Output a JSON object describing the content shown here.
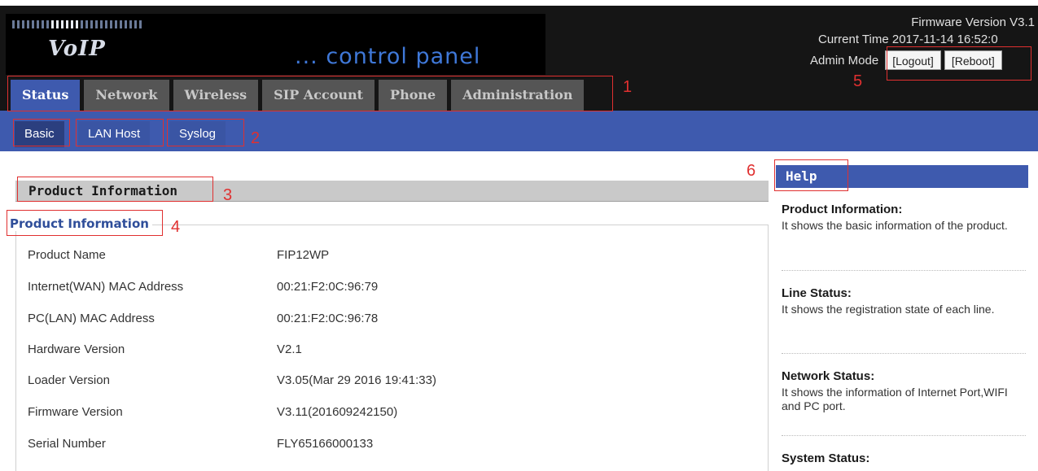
{
  "header": {
    "logo": "VoIP",
    "subtitle": "... control panel",
    "firmware_line": "Firmware Version V3.1",
    "time_line": "Current Time 2017-11-14 16:52:0",
    "admin_mode": "Admin Mode",
    "logout": "[Logout]",
    "reboot": "[Reboot]"
  },
  "tabs": [
    {
      "label": "Status"
    },
    {
      "label": "Network"
    },
    {
      "label": "Wireless"
    },
    {
      "label": "SIP Account"
    },
    {
      "label": "Phone"
    },
    {
      "label": "Administration"
    }
  ],
  "subtabs": [
    {
      "label": "Basic"
    },
    {
      "label": "LAN Host"
    },
    {
      "label": "Syslog"
    }
  ],
  "annotations": [
    "1",
    "2",
    "3",
    "4",
    "5",
    "6"
  ],
  "section": {
    "bar_title": "Product Information",
    "legend": "Product Information",
    "rows": [
      {
        "label": "Product Name",
        "value": "FIP12WP"
      },
      {
        "label": "Internet(WAN) MAC Address",
        "value": "00:21:F2:0C:96:79"
      },
      {
        "label": "PC(LAN) MAC Address",
        "value": "00:21:F2:0C:96:78"
      },
      {
        "label": "Hardware Version",
        "value": "V2.1"
      },
      {
        "label": "Loader Version",
        "value": "V3.05(Mar 29 2016 19:41:33)"
      },
      {
        "label": "Firmware Version",
        "value": "V3.11(201609242150)"
      },
      {
        "label": "Serial Number",
        "value": "FLY65166000133"
      }
    ]
  },
  "help": {
    "title": "Help",
    "items": [
      {
        "head": "Product Information:",
        "text": "It shows the basic information of the product."
      },
      {
        "head": "Line Status:",
        "text": "It shows the registration state of each line."
      },
      {
        "head": "Network Status:",
        "text": "It shows the information of Internet Port,WIFI and PC port."
      },
      {
        "head": "System Status:",
        "text": ""
      }
    ]
  },
  "colors": {
    "accent_blue": "#3e5aae",
    "annotation_red": "#e03030",
    "tab_gray": "#555555"
  }
}
